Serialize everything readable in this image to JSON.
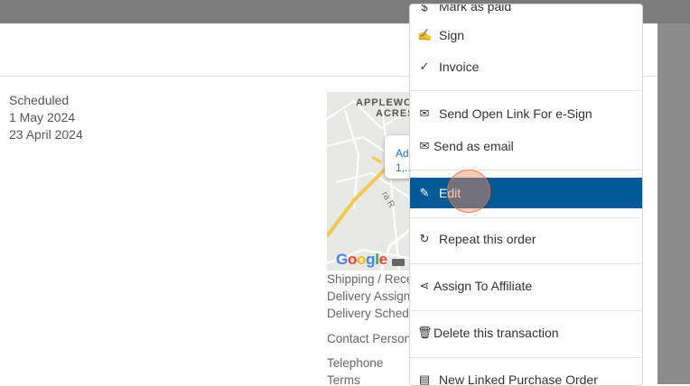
{
  "colors": {
    "active_item_bg": "#005a95",
    "header_button": "#1f62b4"
  },
  "order_info": {
    "status": "Scheduled",
    "date_1": "1 May 2024",
    "date_2": "23 April 2024"
  },
  "map": {
    "area_label_1": "APPLEWO",
    "area_label_2": "ACRES",
    "popup_line_1": "Ad",
    "popup_line_2": "1,...",
    "street_label": "ra R",
    "provider": "Google"
  },
  "details": {
    "shipping": "Shipping / Rece",
    "delivery_assigned": "Delivery Assigne",
    "delivery_scheduled": "Delivery Schedu",
    "contact_person": "Contact Person",
    "telephone": "Telephone",
    "terms": "Terms"
  },
  "menu": {
    "mark_as_paid": "Mark as paid",
    "sign": "Sign",
    "invoice": "Invoice",
    "send_open_link": "Send Open Link For e-Sign",
    "send_as_email": "Send as email",
    "edit": "Edit",
    "repeat_order": "Repeat this order",
    "assign_affiliate": "Assign To Affiliate",
    "delete_transaction": "Delete this transaction",
    "new_linked_po": "New Linked Purchase Order"
  }
}
